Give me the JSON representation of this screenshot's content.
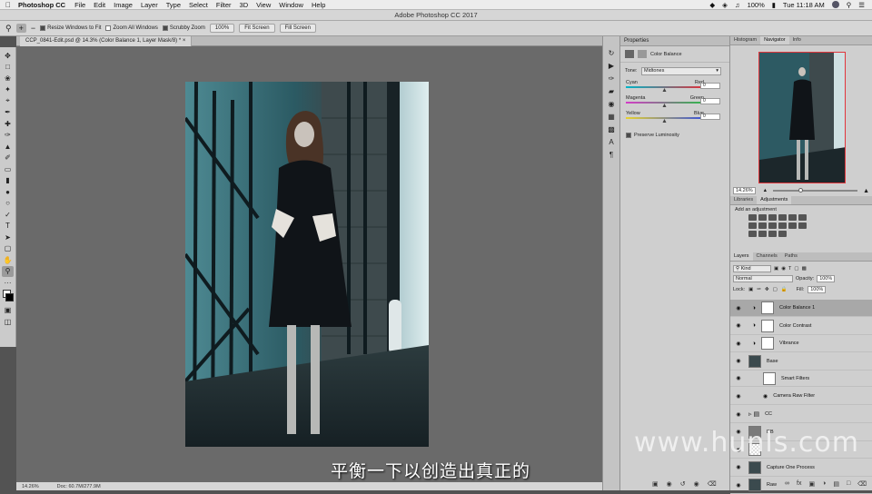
{
  "menubar": {
    "app": "Photoshop CC",
    "items": [
      "File",
      "Edit",
      "Image",
      "Layer",
      "Type",
      "Select",
      "Filter",
      "3D",
      "View",
      "Window",
      "Help"
    ],
    "battery": "100%",
    "clock": "Tue 11:18 AM"
  },
  "window": {
    "title": "Adobe Photoshop CC 2017"
  },
  "options": {
    "resize": "Resize Windows to Fit",
    "zoom_all": "Zoom All Windows",
    "scrubby": "Scrubby Zoom",
    "zoom_pct": "100%",
    "fit": "Fit Screen",
    "fill": "Fill Screen"
  },
  "document": {
    "tab": "CCP_0841-Edit.psd @ 14.3% (Color Balance 1, Layer Mask/8) *"
  },
  "status": {
    "zoom": "14.26%",
    "doc": "Doc: 60.7M/277.9M"
  },
  "properties": {
    "tab": "Properties",
    "title": "Color Balance",
    "tone_label": "Tone:",
    "tone_value": "Midtones",
    "sliders": [
      {
        "left": "Cyan",
        "right": "Red",
        "value": "0",
        "pos": 0.5,
        "c1": "#00b5c8",
        "c2": "#e0303a"
      },
      {
        "left": "Magenta",
        "right": "Green",
        "value": "0",
        "pos": 0.5,
        "c1": "#d43cc8",
        "c2": "#2fb84a"
      },
      {
        "left": "Yellow",
        "right": "Blue",
        "value": "0",
        "pos": 0.5,
        "c1": "#e6d230",
        "c2": "#3a52d8"
      }
    ],
    "preserve": "Preserve Luminosity"
  },
  "navigator": {
    "tabs": [
      "Histogram",
      "Navigator",
      "Info"
    ],
    "zoom": "14.26%"
  },
  "adjustments": {
    "tabs": [
      "Libraries",
      "Adjustments"
    ],
    "heading": "Add an adjustment"
  },
  "layers": {
    "tabs": [
      "Layers",
      "Channels",
      "Paths"
    ],
    "kind": "Kind",
    "blend": "Normal",
    "opacity_label": "Opacity:",
    "opacity": "100%",
    "lock_label": "Lock:",
    "fill_label": "Fill:",
    "fill": "100%",
    "items": [
      "Color Balance 1",
      "Color Contrast",
      "Vibrance",
      "Base",
      "Smart Filters",
      "Camera Raw Filter",
      "CC",
      "DB",
      "",
      "Capture One Process",
      "Raw"
    ]
  },
  "subtitle": "平衡一下以创造出真正的",
  "watermark": "www.hunls.com"
}
